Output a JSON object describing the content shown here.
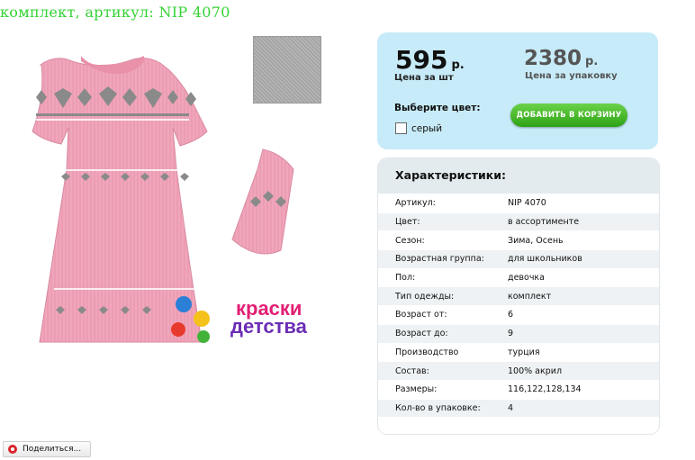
{
  "header": {
    "title": "комплект, артикул: NIP 4070"
  },
  "brand": {
    "logo_text": "краски детства"
  },
  "price": {
    "unit_value": "595",
    "unit_currency": "р.",
    "unit_label": "Цена за шт",
    "pack_value": "2380",
    "pack_currency": "р.",
    "pack_label": "Цена за упаковку"
  },
  "color_select": {
    "label": "Выберите цвет:",
    "option_label": "серый",
    "checked": false
  },
  "cart_button": {
    "label": "ДОБАВИТЬ В КОРЗИНУ"
  },
  "characteristics": {
    "title": "Характеристики:",
    "rows": [
      {
        "key": "Артикул:",
        "value": "NIP 4070"
      },
      {
        "key": "Цвет:",
        "value": "в ассортименте"
      },
      {
        "key": "Сезон:",
        "value": "Зима, Осень"
      },
      {
        "key": "Возрастная группа:",
        "value": "для школьников"
      },
      {
        "key": "Пол:",
        "value": "девочка"
      },
      {
        "key": "Тип одежды:",
        "value": "комплект"
      },
      {
        "key": "Возраст от:",
        "value": "6"
      },
      {
        "key": "Возраст до:",
        "value": "9"
      },
      {
        "key": "Производство",
        "value": "турция"
      },
      {
        "key": "Состав:",
        "value": "100% акрил"
      },
      {
        "key": "Размеры:",
        "value": "116,122,128,134"
      },
      {
        "key": "Кол-во в упаковке:",
        "value": "4"
      }
    ]
  },
  "share": {
    "label": "Поделиться..."
  },
  "colors": {
    "title_green": "#35d335",
    "dress_pink": "#f0a6bb",
    "pattern_grey": "#8c8c8c",
    "swatch_grey": "#a9a9a9",
    "price_panel": "#c7ebf8",
    "cart_green": "#3bb51f"
  }
}
